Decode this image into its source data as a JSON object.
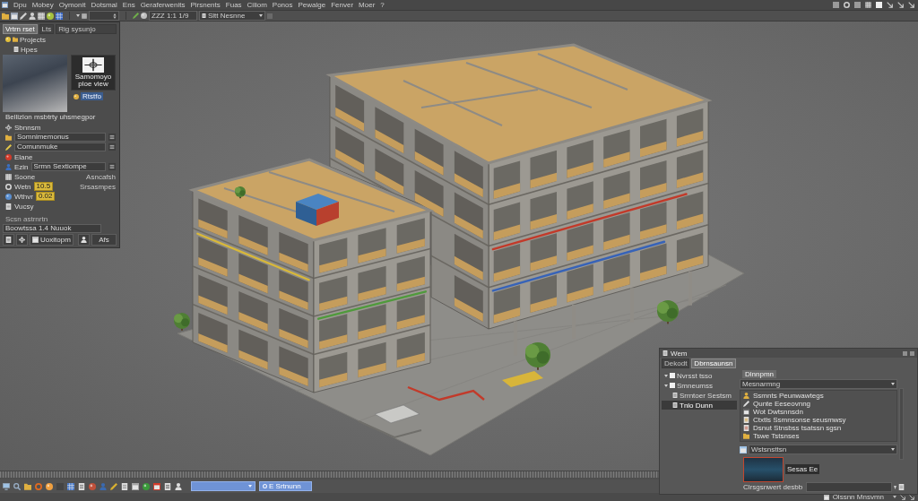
{
  "menu_bar": {
    "items": [
      "Dpu",
      "Mobey",
      "Oymonit",
      "Dotsmal",
      "Ens",
      "Geraferwenits",
      "Pirsnents",
      "Fuas",
      "Ciliom",
      "Ponos",
      "Pewalge",
      "Fenver",
      "Moer",
      "?"
    ]
  },
  "toolbar": {
    "scale_field": "ZZZ 1:1 1/9",
    "view_dropdown": "Sltt Nesnne"
  },
  "scene_panel": {
    "tabs": [
      {
        "label": "Vrtrn rset",
        "selected": true
      },
      {
        "label": "Lts",
        "selected": false
      },
      {
        "label": "Rig sysunjo",
        "selected": false
      }
    ],
    "tree": [
      {
        "label": "Projects",
        "children": [
          {
            "label": "Hpes"
          }
        ]
      }
    ],
    "preview_caption": "Samomoyo ploe view",
    "preview_badge": "Rtstfo",
    "caption": "Bellizlon msbtrty uhsmegpor",
    "group": "Sbnnsm",
    "rows": [
      {
        "kind": "field",
        "value": "Somnimemonus"
      },
      {
        "kind": "field",
        "value": "Comunmuke"
      },
      {
        "kind": "item",
        "label": "Elane"
      },
      {
        "kind": "field",
        "label": "Ezin",
        "value": "Srmn Sextiompe"
      },
      {
        "kind": "item",
        "label": "Soone",
        "note": "Asncafsh"
      },
      {
        "kind": "value",
        "label": "Wetn",
        "value": "10.5",
        "note": "Srsasmpes"
      },
      {
        "kind": "value",
        "label": "Wthvr",
        "value": "0.02"
      },
      {
        "kind": "item",
        "label": "Vucsy"
      }
    ],
    "hint": "Scsn astrnrtn",
    "footer_field": "Boowtssa 1.4 Nuuok",
    "footer_button": "Uoxitopm",
    "action_button": "Afs"
  },
  "library_panel": {
    "title": "Wem",
    "tabs": [
      {
        "label": "Dekodt",
        "selected": false
      },
      {
        "label": "Dbrnsaunsn",
        "selected": true
      }
    ],
    "tree": [
      {
        "label": "Nvrsst tsso",
        "selected": false
      },
      {
        "label": "Smneumss",
        "selected": false,
        "children": [
          {
            "label": "Srrntoer Sestsm",
            "selected": false
          },
          {
            "label": "Tnlo Dunn",
            "selected": true
          }
        ]
      }
    ],
    "popup_title": "Dlnnpmn",
    "category_dropdown": "Mesnarmng",
    "items": [
      "Ssmnts Peunwawtegs",
      "Qunte Eeseovnng",
      "Wot Dwtsnnsdn",
      "Ctxtls Ssmnsonse seusmwsy",
      "Dsnut Stnsbss tsatssn sgsn",
      "Tswe Tstsnses"
    ],
    "filter_dropdown": "Wstsnsttsn",
    "thumbnail_caption": "Sesas Ee",
    "path_label": "Clrsgsnwert desbb"
  },
  "bottom_toolbar": {
    "layer_dropdown": "E Srtnunn"
  },
  "status_bar": {
    "text": "Olssnn Mnsvmn"
  }
}
